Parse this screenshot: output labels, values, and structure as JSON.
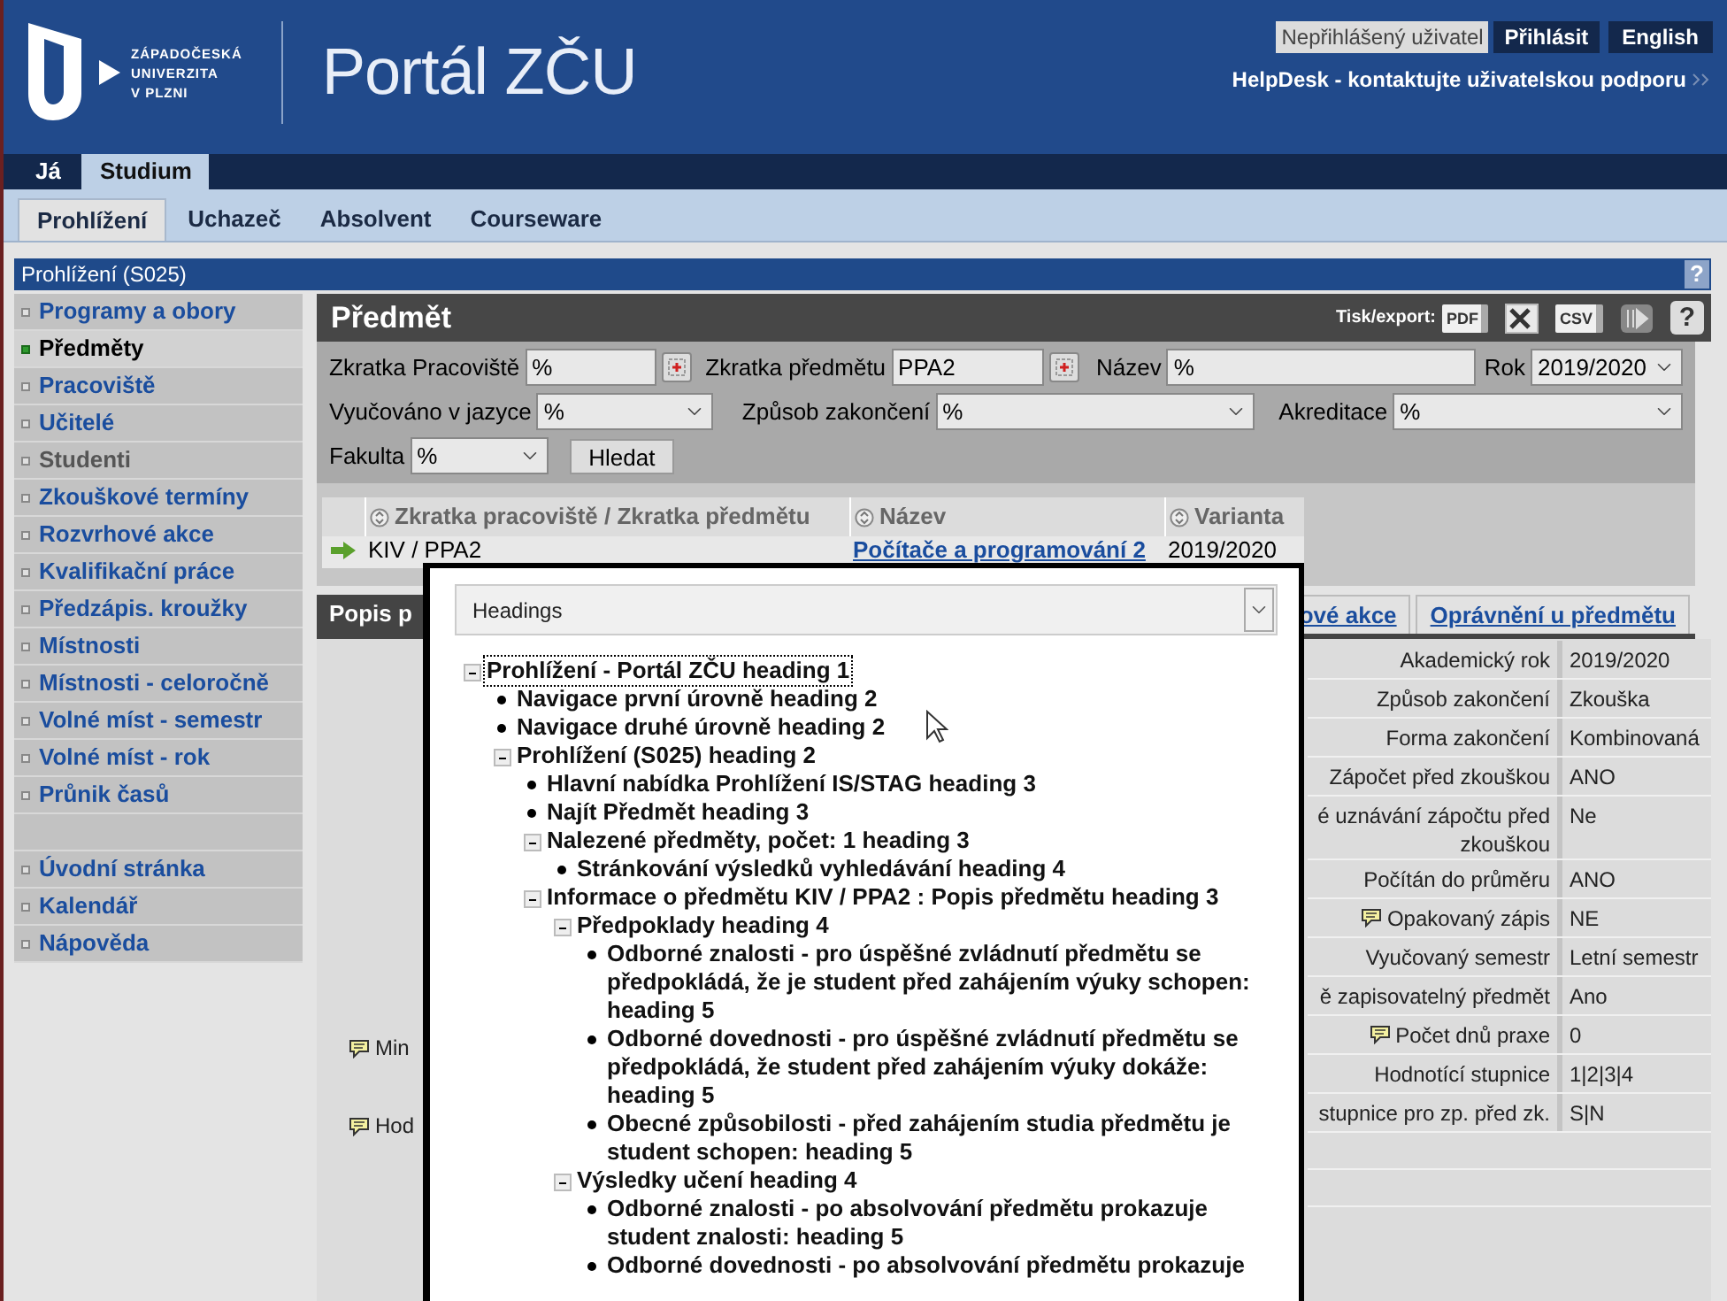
{
  "header": {
    "logo_lines": [
      "ZÁPADOČESKÁ",
      "UNIVERZITA",
      "V PLZNI"
    ],
    "title": "Portál ZČU",
    "user_status": "Nepřihlášený uživatel",
    "login": "Přihlásit",
    "language": "English",
    "helpdesk": "HelpDesk - kontaktujte uživatelskou podporu"
  },
  "top_tabs": [
    {
      "label": "Já",
      "selected": false
    },
    {
      "label": "Studium",
      "selected": true
    }
  ],
  "sub_tabs": [
    {
      "label": "Prohlížení",
      "selected": true
    },
    {
      "label": "Uchazeč",
      "selected": false
    },
    {
      "label": "Absolvent",
      "selected": false
    },
    {
      "label": "Courseware",
      "selected": false
    }
  ],
  "section_bar": {
    "title": "Prohlížení (S025)",
    "help": "?"
  },
  "sidebar": {
    "items": [
      {
        "kind": "link",
        "label": "Programy a obory",
        "selected": false,
        "disabled": false
      },
      {
        "kind": "link",
        "label": "Předměty",
        "selected": true,
        "disabled": false
      },
      {
        "kind": "link",
        "label": "Pracoviště",
        "selected": false,
        "disabled": false
      },
      {
        "kind": "link",
        "label": "Učitelé",
        "selected": false,
        "disabled": false
      },
      {
        "kind": "link",
        "label": "Studenti",
        "selected": false,
        "disabled": true
      },
      {
        "kind": "link",
        "label": "Zkouškové termíny",
        "selected": false,
        "disabled": false
      },
      {
        "kind": "link",
        "label": "Rozvrhové akce",
        "selected": false,
        "disabled": false
      },
      {
        "kind": "link",
        "label": "Kvalifikační práce",
        "selected": false,
        "disabled": false
      },
      {
        "kind": "link",
        "label": "Předzápis. kroužky",
        "selected": false,
        "disabled": false
      },
      {
        "kind": "link",
        "label": "Místnosti",
        "selected": false,
        "disabled": false
      },
      {
        "kind": "link",
        "label": "Místnosti - celoročně",
        "selected": false,
        "disabled": false
      },
      {
        "kind": "link",
        "label": "Volné míst - semestr",
        "selected": false,
        "disabled": false
      },
      {
        "kind": "link",
        "label": "Volné míst - rok",
        "selected": false,
        "disabled": false
      },
      {
        "kind": "link",
        "label": "Průnik časů",
        "selected": false,
        "disabled": false
      },
      {
        "kind": "spacer"
      },
      {
        "kind": "link",
        "label": "Úvodní stránka",
        "selected": false,
        "disabled": false
      },
      {
        "kind": "link",
        "label": "Kalendář",
        "selected": false,
        "disabled": false
      },
      {
        "kind": "link",
        "label": "Nápověda",
        "selected": false,
        "disabled": false
      }
    ]
  },
  "panel": {
    "title": "Předmět",
    "export_label": "Tisk/export:",
    "export_buttons": [
      {
        "kind": "pdf",
        "label": "PDF"
      },
      {
        "kind": "excel"
      },
      {
        "kind": "csv",
        "label": "CSV"
      }
    ],
    "help": "?"
  },
  "filter_rows": [
    [
      {
        "kind": "text",
        "label": "Zkratka Pracoviště",
        "value": "%",
        "clearable": true
      },
      {
        "kind": "text",
        "label": "Zkratka předmětu",
        "value": "PPA2",
        "clearable": true
      },
      {
        "kind": "text",
        "label": "Název",
        "value": "%",
        "clearable": false
      },
      {
        "kind": "select",
        "label": "Rok",
        "value": "2019/2020"
      }
    ],
    [
      {
        "kind": "select",
        "label": "Vyučováno v jazyce",
        "value": "%"
      },
      {
        "kind": "select",
        "label": "Způsob zakončení",
        "value": "%"
      },
      {
        "kind": "select",
        "label": "Akreditace",
        "value": "%"
      }
    ],
    [
      {
        "kind": "select",
        "label": "Fakulta",
        "value": "%"
      }
    ]
  ],
  "search_button": "Hledat",
  "results": {
    "columns": [
      "Zkratka pracoviště / Zkratka předmětu",
      "Název",
      "Varianta"
    ],
    "rows": [
      {
        "selected": true,
        "cells": [
          "KIV / PPA2",
          "Počítače a programování 2",
          "2019/2020"
        ]
      }
    ]
  },
  "detail_tabs": [
    {
      "label": "Popis p",
      "selected": true
    },
    {
      "label": "ové akce",
      "selected": false
    },
    {
      "label": "Oprávnění u předmětu",
      "selected": false
    }
  ],
  "detail_left": [
    {
      "label": "Min",
      "note": true
    },
    {
      "label": "Hod",
      "note": true
    }
  ],
  "details": [
    {
      "label": "Akademický rok",
      "value": "2019/2020",
      "note": false
    },
    {
      "label": "Způsob zakončení",
      "value": "Zkouška",
      "note": false
    },
    {
      "label": "Forma zakončení",
      "value": "Kombinovaná",
      "note": false
    },
    {
      "label": "Zápočet před zkouškou",
      "value": "ANO",
      "note": false
    },
    {
      "label": "é uznávání zápočtu před zkouškou",
      "value": "Ne",
      "note": false
    },
    {
      "label": "Počítán do průměru",
      "value": "ANO",
      "note": false
    },
    {
      "label": "Opakovaný zápis",
      "value": "NE",
      "note": true
    },
    {
      "label": "Vyučovaný semestr",
      "value": "Letní semestr",
      "note": false
    },
    {
      "label": "ě zapisovatelný předmět",
      "value": "Ano",
      "note": false
    },
    {
      "label": "Počet dnů praxe",
      "value": "0",
      "note": true
    },
    {
      "label": "Hodnotící stupnice",
      "value": "1|2|3|4",
      "note": false
    },
    {
      "label": "stupnice pro zp. před zk.",
      "value": "S|N",
      "note": false
    }
  ],
  "headings_dialog": {
    "select": "Headings",
    "tree": [
      {
        "text": "Prohlížení - Portál ZČU heading 1",
        "selected": true,
        "expanded": true,
        "children": [
          {
            "text": "Navigace první úrovně heading 2",
            "selected": false
          },
          {
            "text": "Navigace druhé úrovně heading 2",
            "selected": false
          },
          {
            "text": "Prohlížení (S025) heading 2",
            "selected": false,
            "expanded": true,
            "children": [
              {
                "text": "Hlavní nabídka Prohlížení IS/STAG heading 3",
                "selected": false
              },
              {
                "text": "Najít Předmět heading 3",
                "selected": false
              },
              {
                "text": "Nalezené předměty, počet: 1 heading 3",
                "selected": false,
                "expanded": true,
                "children": [
                  {
                    "text": "Stránkování výsledků vyhledávání heading 4",
                    "selected": false
                  }
                ]
              },
              {
                "text": "Informace o předmětu KIV / PPA2 : Popis předmětu heading 3",
                "selected": false,
                "expanded": true,
                "children": [
                  {
                    "text": "Předpoklady heading 4",
                    "selected": false,
                    "expanded": true,
                    "children": [
                      {
                        "text": "Odborné znalosti - pro úspěšné zvládnutí předmětu se předpokládá, že je student před zahájením výuky schopen: heading 5",
                        "selected": false
                      },
                      {
                        "text": "Odborné dovednosti - pro úspěšné zvládnutí předmětu se předpokládá, že student před zahájením výuky dokáže: heading 5",
                        "selected": false
                      },
                      {
                        "text": "Obecné způsobilosti - před zahájením studia předmětu je student schopen: heading 5",
                        "selected": false
                      }
                    ]
                  },
                  {
                    "text": "Výsledky učení heading 4",
                    "selected": false,
                    "expanded": true,
                    "children": [
                      {
                        "text": "Odborné znalosti - po absolvování předmětu prokazuje student znalosti: heading 5",
                        "selected": false
                      },
                      {
                        "text": "Odborné dovednosti - po absolvování předmětu prokazuje",
                        "selected": false
                      }
                    ]
                  }
                ]
              }
            ]
          }
        ]
      }
    ]
  }
}
